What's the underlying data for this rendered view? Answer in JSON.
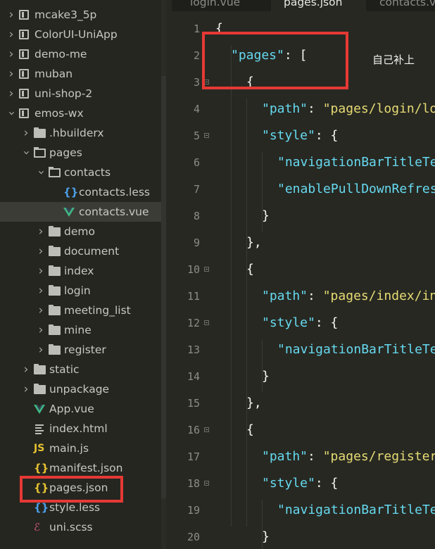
{
  "sidebar": {
    "items": [
      {
        "label": "mcake3_5p",
        "type": "project",
        "depth": 0,
        "expanded": false
      },
      {
        "label": "ColorUI-UniApp",
        "type": "project",
        "depth": 0,
        "expanded": false
      },
      {
        "label": "demo-me",
        "type": "project",
        "depth": 0,
        "expanded": false
      },
      {
        "label": "muban",
        "type": "project",
        "depth": 0,
        "expanded": false
      },
      {
        "label": "uni-shop-2",
        "type": "project",
        "depth": 0,
        "expanded": false
      },
      {
        "label": "emos-wx",
        "type": "project",
        "depth": 0,
        "expanded": true
      },
      {
        "label": ".hbuilderx",
        "type": "folder",
        "depth": 1,
        "expanded": false
      },
      {
        "label": "pages",
        "type": "folder",
        "depth": 1,
        "expanded": true
      },
      {
        "label": "contacts",
        "type": "folder",
        "depth": 2,
        "expanded": true
      },
      {
        "label": "contacts.less",
        "type": "less",
        "depth": 3
      },
      {
        "label": "contacts.vue",
        "type": "vue",
        "depth": 3,
        "selected": true
      },
      {
        "label": "demo",
        "type": "folder",
        "depth": 2,
        "expanded": false
      },
      {
        "label": "document",
        "type": "folder",
        "depth": 2,
        "expanded": false
      },
      {
        "label": "index",
        "type": "folder",
        "depth": 2,
        "expanded": false
      },
      {
        "label": "login",
        "type": "folder",
        "depth": 2,
        "expanded": false
      },
      {
        "label": "meeting_list",
        "type": "folder",
        "depth": 2,
        "expanded": false
      },
      {
        "label": "mine",
        "type": "folder",
        "depth": 2,
        "expanded": false
      },
      {
        "label": "register",
        "type": "folder",
        "depth": 2,
        "expanded": false
      },
      {
        "label": "static",
        "type": "folder",
        "depth": 1,
        "expanded": false
      },
      {
        "label": "unpackage",
        "type": "folder",
        "depth": 1,
        "expanded": false
      },
      {
        "label": "App.vue",
        "type": "vue",
        "depth": 1
      },
      {
        "label": "index.html",
        "type": "html",
        "depth": 1
      },
      {
        "label": "main.js",
        "type": "js",
        "depth": 1
      },
      {
        "label": "manifest.json",
        "type": "json",
        "depth": 1
      },
      {
        "label": "pages.json",
        "type": "json",
        "depth": 1,
        "boxed": true
      },
      {
        "label": "style.less",
        "type": "less",
        "depth": 1
      },
      {
        "label": "uni.scss",
        "type": "scss",
        "depth": 1
      }
    ]
  },
  "tabs": [
    {
      "label": "login.vue",
      "active": false
    },
    {
      "label": "pages.json",
      "active": true
    },
    {
      "label": "contacts.vue",
      "active": false
    }
  ],
  "editor": {
    "lines": [
      {
        "n": "1",
        "fold": false,
        "indent": 0,
        "tokens": [
          [
            "pun",
            "{"
          ]
        ]
      },
      {
        "n": "2",
        "fold": false,
        "indent": 1,
        "tokens": [
          [
            "key",
            "\"pages\""
          ],
          [
            "pun",
            ": ["
          ]
        ]
      },
      {
        "n": "3",
        "fold": true,
        "indent": 2,
        "tokens": [
          [
            "pun",
            "{"
          ]
        ]
      },
      {
        "n": "4",
        "fold": false,
        "indent": 3,
        "tokens": [
          [
            "key",
            "\"path\""
          ],
          [
            "pun",
            ": "
          ],
          [
            "str",
            "\"pages/login/login\","
          ]
        ]
      },
      {
        "n": "5",
        "fold": true,
        "indent": 3,
        "tokens": [
          [
            "key",
            "\"style\""
          ],
          [
            "pun",
            ": {"
          ]
        ]
      },
      {
        "n": "6",
        "fold": false,
        "indent": 4,
        "tokens": [
          [
            "key",
            "\"navigationBarTitleText\""
          ]
        ]
      },
      {
        "n": "7",
        "fold": false,
        "indent": 4,
        "tokens": [
          [
            "key",
            "\"enablePullDownRefresh\""
          ]
        ]
      },
      {
        "n": "8",
        "fold": false,
        "indent": 3,
        "tokens": [
          [
            "pun",
            "}"
          ]
        ]
      },
      {
        "n": "9",
        "fold": false,
        "indent": 2,
        "tokens": [
          [
            "pun",
            "},"
          ]
        ]
      },
      {
        "n": "10",
        "fold": true,
        "indent": 2,
        "tokens": [
          [
            "pun",
            "{"
          ]
        ]
      },
      {
        "n": "11",
        "fold": false,
        "indent": 3,
        "tokens": [
          [
            "key",
            "\"path\""
          ],
          [
            "pun",
            ": "
          ],
          [
            "str",
            "\"pages/index/index\","
          ]
        ]
      },
      {
        "n": "12",
        "fold": true,
        "indent": 3,
        "tokens": [
          [
            "key",
            "\"style\""
          ],
          [
            "pun",
            ": {"
          ]
        ]
      },
      {
        "n": "13",
        "fold": false,
        "indent": 4,
        "tokens": [
          [
            "key",
            "\"navigationBarTitleText\""
          ]
        ]
      },
      {
        "n": "14",
        "fold": false,
        "indent": 3,
        "tokens": [
          [
            "pun",
            "}"
          ]
        ]
      },
      {
        "n": "15",
        "fold": false,
        "indent": 2,
        "tokens": [
          [
            "pun",
            "},"
          ]
        ]
      },
      {
        "n": "16",
        "fold": true,
        "indent": 2,
        "tokens": [
          [
            "pun",
            "{"
          ]
        ]
      },
      {
        "n": "17",
        "fold": false,
        "indent": 3,
        "tokens": [
          [
            "key",
            "\"path\""
          ],
          [
            "pun",
            ": "
          ],
          [
            "str",
            "\"pages/register/register\","
          ]
        ]
      },
      {
        "n": "18",
        "fold": true,
        "indent": 3,
        "tokens": [
          [
            "key",
            "\"style\""
          ],
          [
            "pun",
            ": {"
          ]
        ]
      },
      {
        "n": "19",
        "fold": false,
        "indent": 4,
        "tokens": [
          [
            "key",
            "\"navigationBarTitleText\""
          ]
        ]
      },
      {
        "n": "20",
        "fold": false,
        "indent": 3,
        "tokens": [
          [
            "pun",
            "}"
          ]
        ]
      }
    ]
  },
  "annotation": {
    "text": "自己补上",
    "color": "#e53935"
  }
}
